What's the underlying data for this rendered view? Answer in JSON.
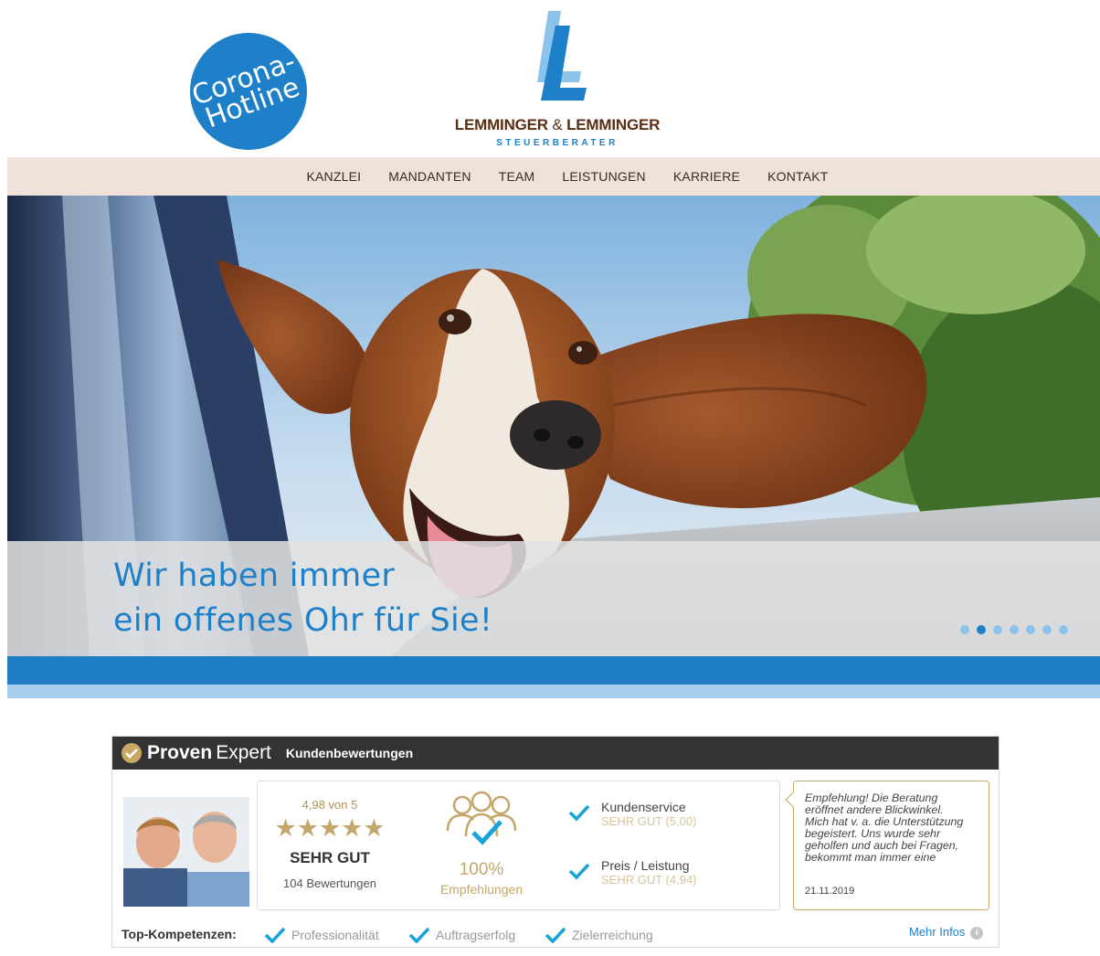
{
  "header": {
    "hotline_line1": "Corona-",
    "hotline_line2": "Hotline",
    "logo_name_left": "LEMMINGER",
    "logo_amp": "&",
    "logo_name_right": "LEMMINGER",
    "logo_subtitle": "STEUERBERATER"
  },
  "nav": {
    "items": [
      "KANZLEI",
      "MANDANTEN",
      "TEAM",
      "LEISTUNGEN",
      "KARRIERE",
      "KONTAKT"
    ]
  },
  "hero": {
    "caption_line1": "Wir haben immer",
    "caption_line2": "ein offenes Ohr für Sie!",
    "slide_count": 7,
    "active_slide": 2
  },
  "widget": {
    "brand_bold": "Proven",
    "brand_light": "Expert",
    "title": "Kundenbewertungen",
    "score": "4,98 von 5",
    "stars": "★★★★★",
    "verdict": "SEHR GUT",
    "review_count": "104 Bewertungen",
    "recommend_pct": "100%",
    "recommend_label": "Empfehlungen",
    "criteria": [
      {
        "name": "Kundenservice",
        "value": "SEHR GUT (5,00)"
      },
      {
        "name": "Preis / Leistung",
        "value": "SEHR GUT (4,94)"
      }
    ],
    "quote_lines": [
      "Empfehlung! Die Beratung",
      "eröffnet andere Blickwinkel.",
      "Mich hat v. a. die Unterstützung",
      "begeistert. Uns wurde sehr",
      "geholfen und auch bei Fragen,",
      "bekommt man immer eine"
    ],
    "quote_date": "21.11.2019",
    "top_label": "Top-Kompetenzen:",
    "competences": [
      "Professionalität",
      "Auftragserfolg",
      "Zielerreichung"
    ],
    "more_label": "Mehr Infos",
    "info_glyph": "i"
  },
  "colors": {
    "brand_blue": "#1e80c8",
    "brand_brown": "#5b2e14",
    "nav_bg": "#efe2da",
    "gold": "#c4a76a",
    "check_blue": "#1aa3d9"
  }
}
